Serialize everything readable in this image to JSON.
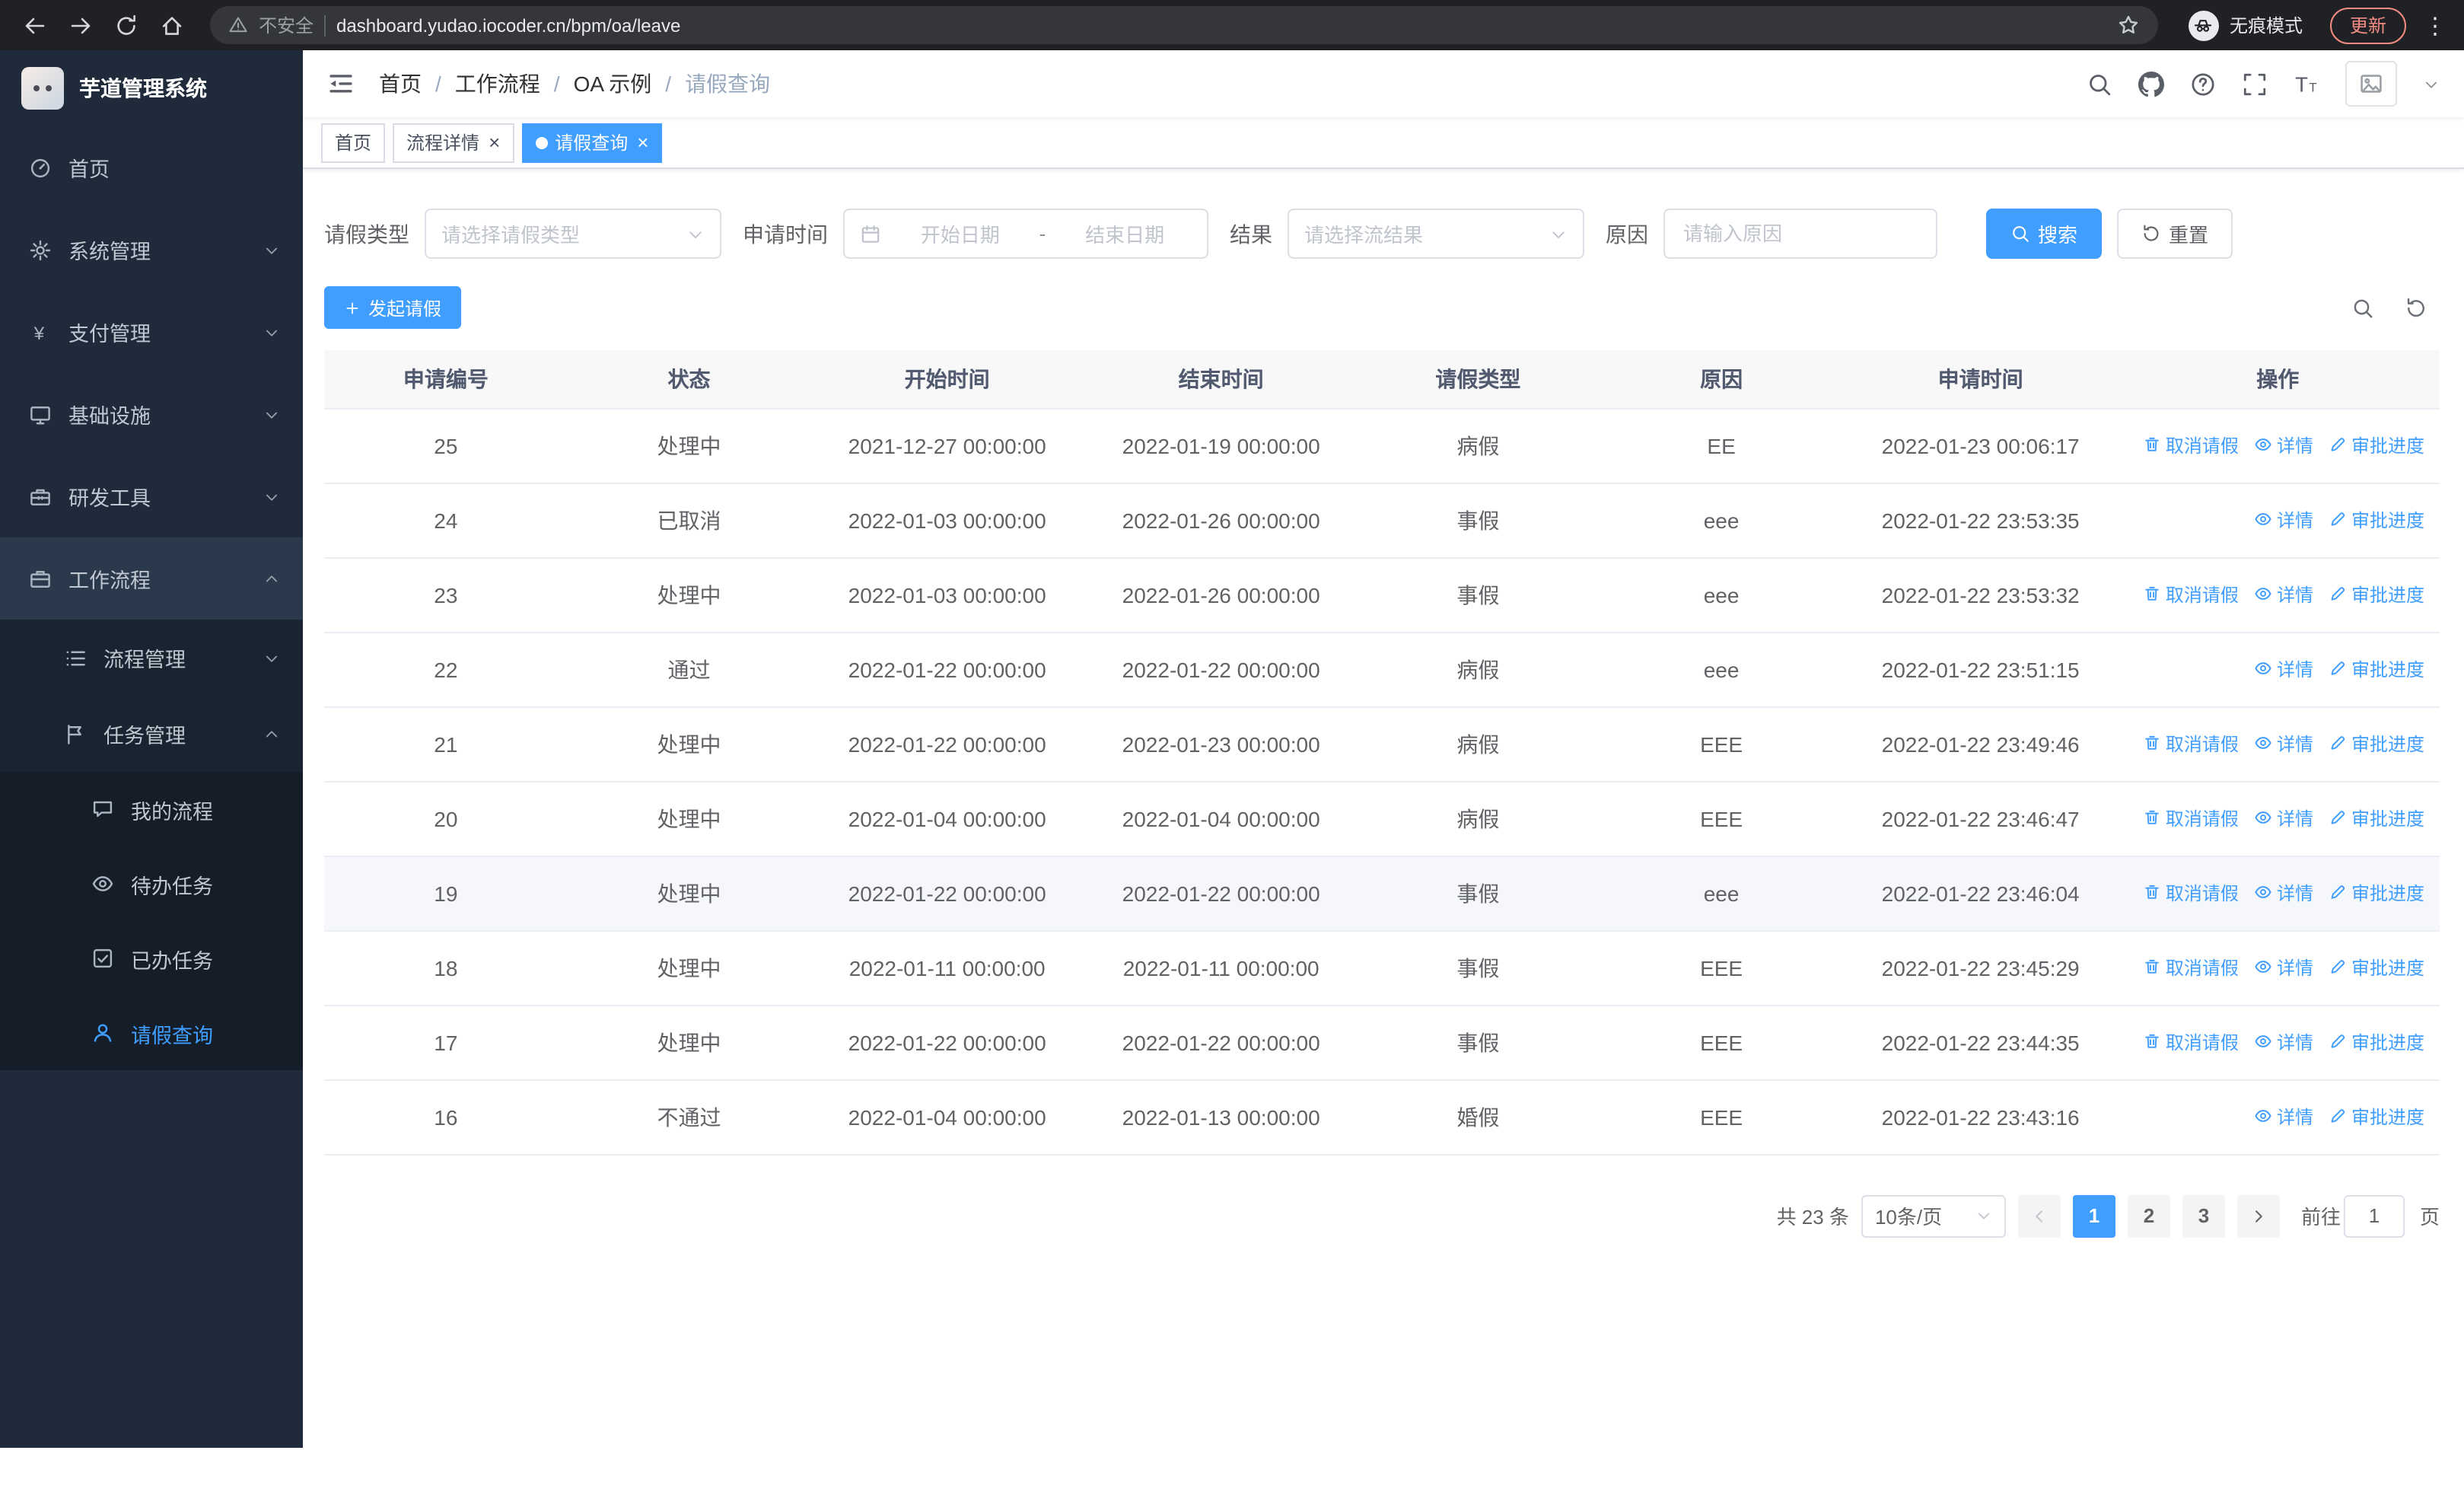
{
  "browser": {
    "security_warning": "不安全",
    "url": "dashboard.yudao.iocoder.cn/bpm/oa/leave",
    "incognito_label": "无痕模式",
    "update_label": "更新"
  },
  "sidebar": {
    "logo_title": "芋道管理系统",
    "items": [
      {
        "name": "sidebar-item-home",
        "label": "首页",
        "icon": "dashboard-icon",
        "level": 1
      },
      {
        "name": "sidebar-item-system",
        "label": "系统管理",
        "icon": "gear-icon",
        "level": 1,
        "chevron": "down"
      },
      {
        "name": "sidebar-item-payment",
        "label": "支付管理",
        "icon": "yen-icon",
        "level": 1,
        "chevron": "down"
      },
      {
        "name": "sidebar-item-infrastructure",
        "label": "基础设施",
        "icon": "monitor-icon",
        "level": 1,
        "chevron": "down"
      },
      {
        "name": "sidebar-item-devtools",
        "label": "研发工具",
        "icon": "toolbox-icon",
        "level": 1,
        "chevron": "down"
      },
      {
        "name": "sidebar-item-workflow",
        "label": "工作流程",
        "icon": "briefcase-icon",
        "level": 1,
        "chevron": "up",
        "open": true
      },
      {
        "name": "sidebar-item-process-management",
        "label": "流程管理",
        "icon": "list-icon",
        "level": 2,
        "chevron": "down"
      },
      {
        "name": "sidebar-item-task-management",
        "label": "任务管理",
        "icon": "flag-icon",
        "level": 2,
        "chevron": "up"
      },
      {
        "name": "sidebar-item-my-process",
        "label": "我的流程",
        "icon": "chat-icon",
        "level": 3
      },
      {
        "name": "sidebar-item-todo-tasks",
        "label": "待办任务",
        "icon": "eye-icon",
        "level": 3
      },
      {
        "name": "sidebar-item-done-tasks",
        "label": "已办任务",
        "icon": "check-square-icon",
        "level": 3
      },
      {
        "name": "sidebar-item-leave-query",
        "label": "请假查询",
        "icon": "user-icon",
        "level": 3,
        "active": true
      }
    ]
  },
  "header": {
    "breadcrumb": [
      "首页",
      "工作流程",
      "OA 示例",
      "请假查询"
    ]
  },
  "tabs": [
    {
      "name": "tab-home",
      "label": "首页",
      "closable": false,
      "active": false
    },
    {
      "name": "tab-process-detail",
      "label": "流程详情",
      "closable": true,
      "active": false
    },
    {
      "name": "tab-leave-query",
      "label": "请假查询",
      "closable": true,
      "active": true
    }
  ],
  "filters": {
    "leave_type_label": "请假类型",
    "leave_type_placeholder": "请选择请假类型",
    "apply_time_label": "申请时间",
    "start_date_placeholder": "开始日期",
    "range_separator": "-",
    "end_date_placeholder": "结束日期",
    "result_label": "结果",
    "result_placeholder": "请选择流结果",
    "reason_label": "原因",
    "reason_placeholder": "请输入原因",
    "search_label": "搜索",
    "reset_label": "重置"
  },
  "toolbar": {
    "create_label": "发起请假"
  },
  "table": {
    "columns": [
      "申请编号",
      "状态",
      "开始时间",
      "结束时间",
      "请假类型",
      "原因",
      "申请时间",
      "操作"
    ],
    "rows": [
      {
        "id": "25",
        "status": "处理中",
        "start": "2021-12-27 00:00:00",
        "end": "2022-01-19 00:00:00",
        "type": "病假",
        "reason": "EE",
        "applied": "2022-01-23 00:06:17",
        "actions": [
          "取消请假",
          "详情",
          "审批进度"
        ]
      },
      {
        "id": "24",
        "status": "已取消",
        "start": "2022-01-03 00:00:00",
        "end": "2022-01-26 00:00:00",
        "type": "事假",
        "reason": "eee",
        "applied": "2022-01-22 23:53:35",
        "actions": [
          "详情",
          "审批进度"
        ]
      },
      {
        "id": "23",
        "status": "处理中",
        "start": "2022-01-03 00:00:00",
        "end": "2022-01-26 00:00:00",
        "type": "事假",
        "reason": "eee",
        "applied": "2022-01-22 23:53:32",
        "actions": [
          "取消请假",
          "详情",
          "审批进度"
        ]
      },
      {
        "id": "22",
        "status": "通过",
        "start": "2022-01-22 00:00:00",
        "end": "2022-01-22 00:00:00",
        "type": "病假",
        "reason": "eee",
        "applied": "2022-01-22 23:51:15",
        "actions": [
          "详情",
          "审批进度"
        ]
      },
      {
        "id": "21",
        "status": "处理中",
        "start": "2022-01-22 00:00:00",
        "end": "2022-01-23 00:00:00",
        "type": "病假",
        "reason": "EEE",
        "applied": "2022-01-22 23:49:46",
        "actions": [
          "取消请假",
          "详情",
          "审批进度"
        ]
      },
      {
        "id": "20",
        "status": "处理中",
        "start": "2022-01-04 00:00:00",
        "end": "2022-01-04 00:00:00",
        "type": "病假",
        "reason": "EEE",
        "applied": "2022-01-22 23:46:47",
        "actions": [
          "取消请假",
          "详情",
          "审批进度"
        ]
      },
      {
        "id": "19",
        "status": "处理中",
        "start": "2022-01-22 00:00:00",
        "end": "2022-01-22 00:00:00",
        "type": "事假",
        "reason": "eee",
        "applied": "2022-01-22 23:46:04",
        "actions": [
          "取消请假",
          "详情",
          "审批进度"
        ],
        "highlight": true
      },
      {
        "id": "18",
        "status": "处理中",
        "start": "2022-01-11 00:00:00",
        "end": "2022-01-11 00:00:00",
        "type": "事假",
        "reason": "EEE",
        "applied": "2022-01-22 23:45:29",
        "actions": [
          "取消请假",
          "详情",
          "审批进度"
        ]
      },
      {
        "id": "17",
        "status": "处理中",
        "start": "2022-01-22 00:00:00",
        "end": "2022-01-22 00:00:00",
        "type": "事假",
        "reason": "EEE",
        "applied": "2022-01-22 23:44:35",
        "actions": [
          "取消请假",
          "详情",
          "审批进度"
        ]
      },
      {
        "id": "16",
        "status": "不通过",
        "start": "2022-01-04 00:00:00",
        "end": "2022-01-13 00:00:00",
        "type": "婚假",
        "reason": "EEE",
        "applied": "2022-01-22 23:43:16",
        "actions": [
          "详情",
          "审批进度"
        ]
      }
    ]
  },
  "pagination": {
    "total_text": "共 23 条",
    "page_size": "10条/页",
    "pages": [
      "1",
      "2",
      "3"
    ],
    "active_page": "1",
    "goto_label": "前往",
    "goto_value": "1",
    "goto_suffix": "页"
  },
  "colors": {
    "accent": "#409eff",
    "update_button": "#f28b82",
    "sidebar_bg": "#1f2b3a"
  }
}
